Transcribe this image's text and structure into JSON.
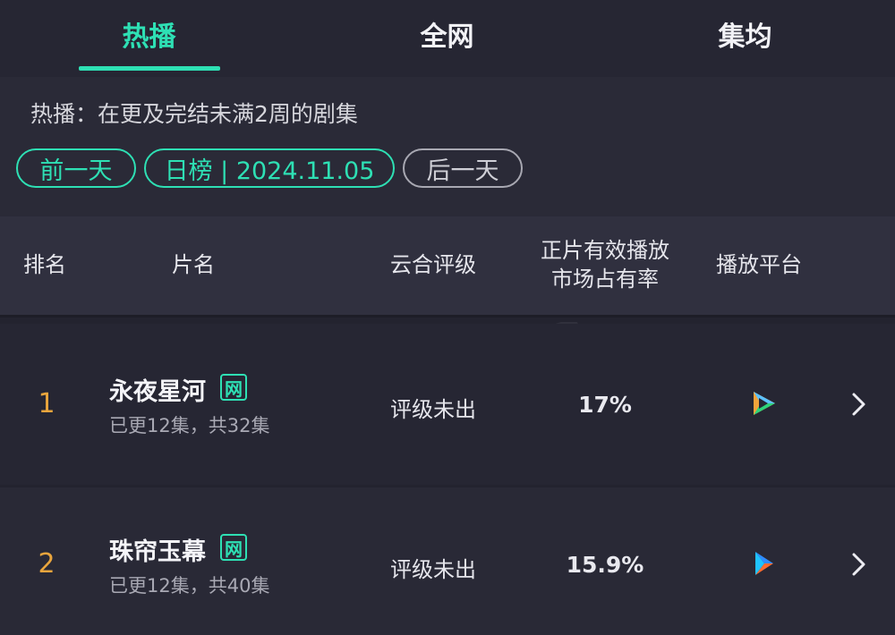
{
  "tabs": [
    {
      "label": "热播",
      "active": true
    },
    {
      "label": "全网",
      "active": false
    },
    {
      "label": "集均",
      "active": false
    }
  ],
  "description": "热播：在更及完结未满2周的剧集",
  "date_nav": {
    "prev_label": "前一天",
    "current_label": "日榜 | 2024.11.05",
    "next_label": "后一天"
  },
  "table": {
    "headers": {
      "rank": "排名",
      "title": "片名",
      "rating": "云合评级",
      "share_line1": "正片有效播放",
      "share_line2": "市场占有率",
      "platform": "播放平台"
    },
    "rows": [
      {
        "rank": "1",
        "title": "永夜星河",
        "badge": "网",
        "episodes": "已更12集，共32集",
        "rating": "评级未出",
        "share": "17%",
        "platform_icon": "iqiyi-play-icon"
      },
      {
        "rank": "2",
        "title": "珠帘玉幕",
        "badge": "网",
        "episodes": "已更12集，共40集",
        "rating": "评级未出",
        "share": "15.9%",
        "platform_icon": "youku-play-icon"
      }
    ]
  },
  "colors": {
    "accent": "#2ee0b4",
    "rank": "#e9a53d",
    "background": "#23232f"
  }
}
